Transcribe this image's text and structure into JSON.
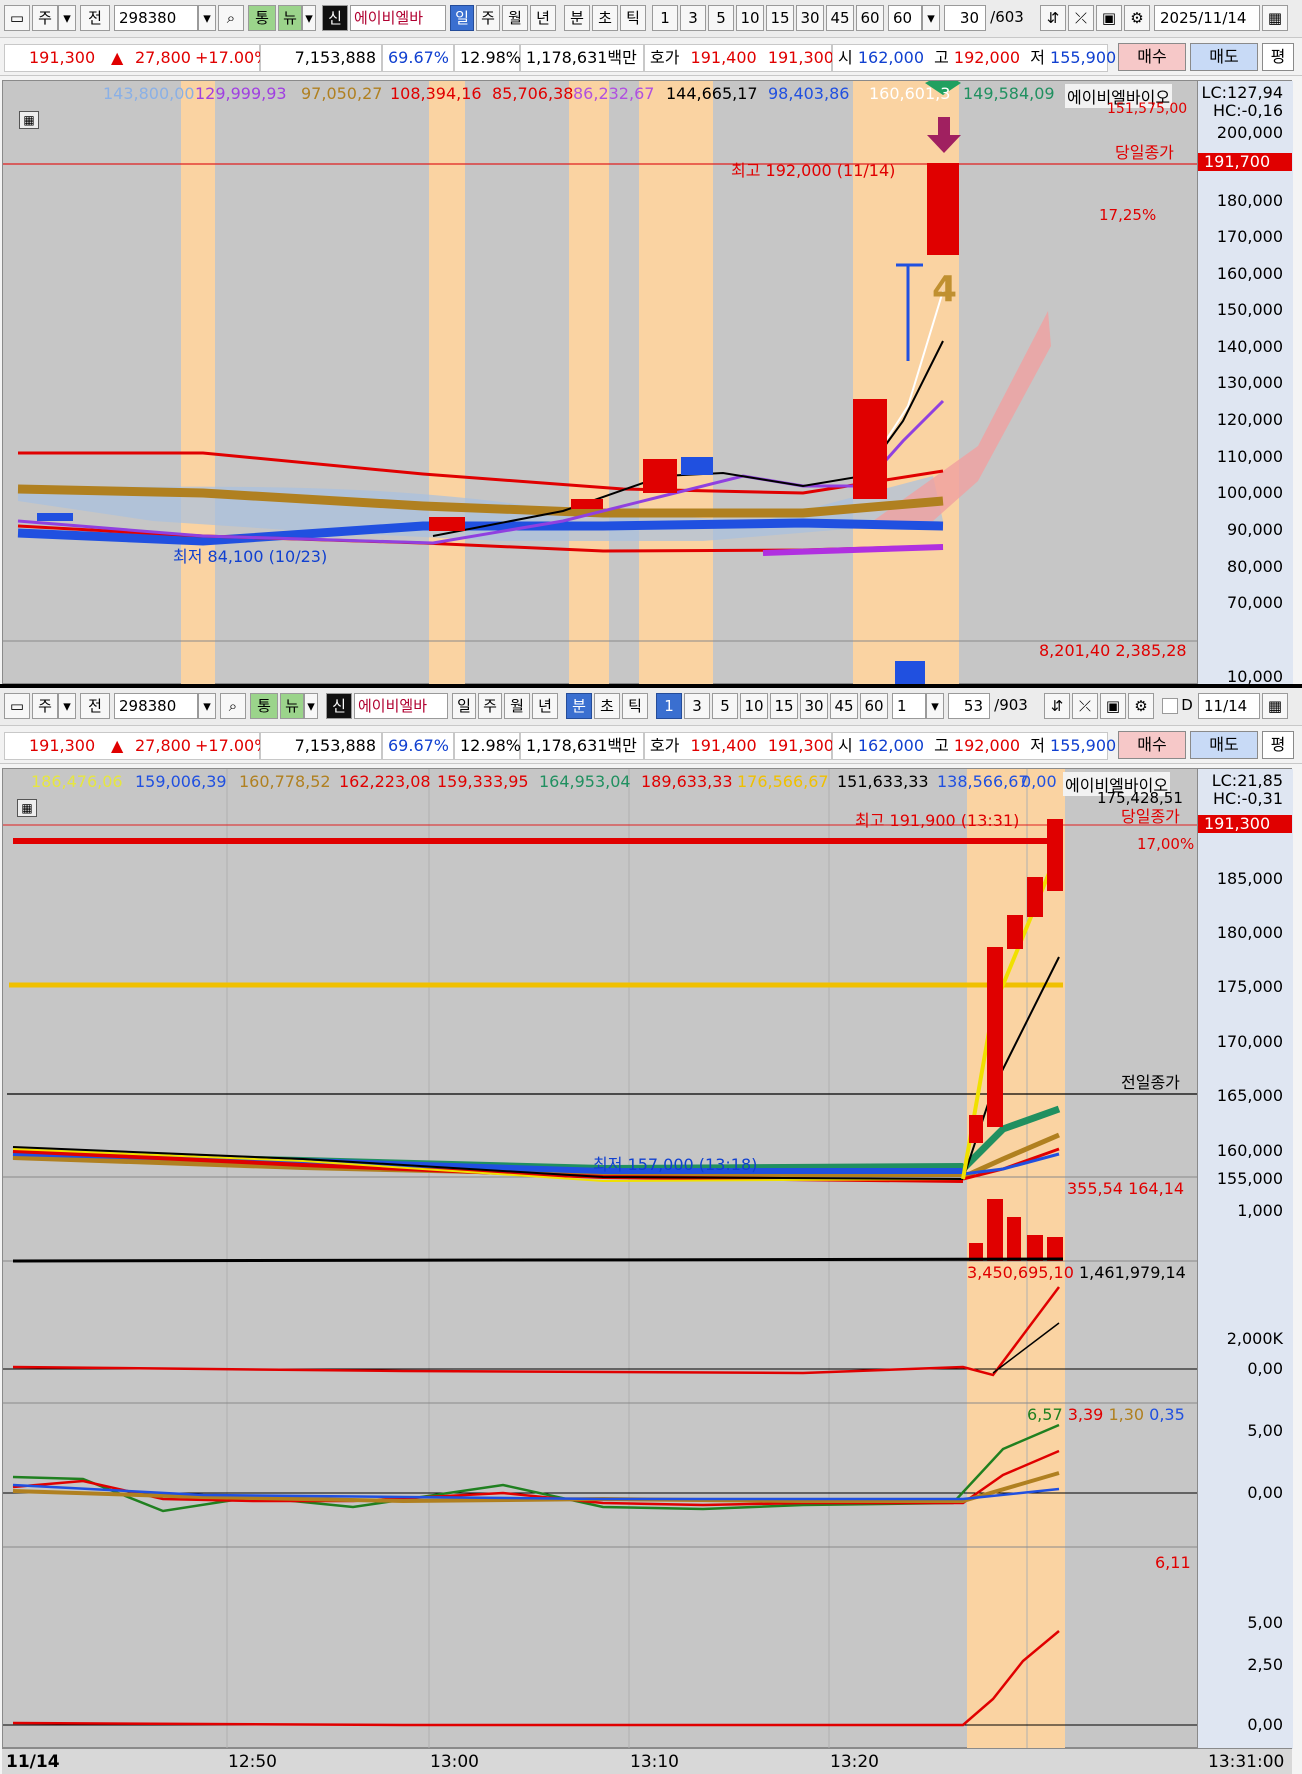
{
  "top": {
    "toolbar": {
      "tab_1": "주",
      "tab_2": "전",
      "code": "298380",
      "badge_tong": "통",
      "badge_nyu": "뉴",
      "badge_sin": "신",
      "name": "에이비엘바",
      "periods": [
        "일",
        "주",
        "월",
        "년",
        "분",
        "초",
        "틱"
      ],
      "active_period": "일",
      "intervals": [
        "1",
        "3",
        "5",
        "10",
        "15",
        "30",
        "45",
        "60"
      ],
      "interval_box": "60",
      "count": "30",
      "count_total": "/603",
      "date": "2025/11/14"
    },
    "quote": {
      "price": "191,300",
      "change": "27,800",
      "change_pct": "+17.00%",
      "volume": "7,153,888",
      "pct1": "69.67%",
      "pct2": "12.98%",
      "amount": "1,178,631백만",
      "ho_label": "호가",
      "ask": "191,400",
      "bid": "191,300",
      "open_label": "시",
      "open": "162,000",
      "high_label": "고",
      "high": "192,000",
      "low_label": "저",
      "low": "155,900",
      "buy": "매수",
      "sell": "매도",
      "avg": "평"
    },
    "legend": [
      {
        "text": "143,800,00",
        "color": "#8ab0e6"
      },
      {
        "text": "129,999,93",
        "color": "#a040e0"
      },
      {
        "text": "97,050,27",
        "color": "#b08020"
      },
      {
        "text": "108,394,16",
        "color": "#e00000"
      },
      {
        "text": "85,706,38",
        "color": "#e00000"
      },
      {
        "text": "86,232,67",
        "color": "#b050e0"
      },
      {
        "text": "144,665,17",
        "color": "#000000"
      },
      {
        "text": "98,403,86",
        "color": "#2050e0"
      },
      {
        "text": "160,601,3",
        "color": "#ffffff"
      },
      {
        "text": "149,584,09",
        "color": "#209060"
      }
    ],
    "stock_label": "에이비엘바이오",
    "lc": "LC:127,94",
    "hc": "HC:-0,16",
    "hc_sub": "151,575,00",
    "close_tag": "당일종가",
    "price_tag": "191,700",
    "pct_tag": "17,25%",
    "high_note": "최고 192,000 (11/14)",
    "low_note": "최저 84,100 (10/23)",
    "candle_number": "4",
    "volume_values": "8,201,40 2,385,28",
    "y_ticks": [
      "200,000",
      "190,000",
      "180,000",
      "170,000",
      "160,000",
      "150,000",
      "140,000",
      "130,000",
      "120,000",
      "110,000",
      "100,000",
      "90,000",
      "80,000",
      "70,000"
    ],
    "vol_tick": "10,000"
  },
  "bottom": {
    "toolbar": {
      "tab_1": "주",
      "tab_2": "전",
      "code": "298380",
      "badge_tong": "통",
      "badge_nyu": "뉴",
      "badge_sin": "신",
      "name": "에이비엘바",
      "periods": [
        "일",
        "주",
        "월",
        "년",
        "분",
        "초",
        "틱"
      ],
      "active_period": "분",
      "intervals": [
        "1",
        "3",
        "5",
        "10",
        "15",
        "30",
        "45",
        "60"
      ],
      "active_interval": "1",
      "interval_box": "1",
      "count": "53",
      "count_total": "/903",
      "check_label": "D",
      "date": "11/14"
    },
    "quote": {
      "price": "191,300",
      "change": "27,800",
      "change_pct": "+17.00%",
      "volume": "7,153,888",
      "pct1": "69.67%",
      "pct2": "12.98%",
      "amount": "1,178,631백만",
      "ho_label": "호가",
      "ask": "191,400",
      "bid": "191,300",
      "open_label": "시",
      "open": "162,000",
      "high_label": "고",
      "high": "192,000",
      "low_label": "저",
      "low": "155,900",
      "buy": "매수",
      "sell": "매도",
      "avg": "평"
    },
    "legend": [
      {
        "text": "186,476,06",
        "color": "#e6e640"
      },
      {
        "text": "159,006,39",
        "color": "#2050e0"
      },
      {
        "text": "160,778,52",
        "color": "#b08020"
      },
      {
        "text": "162,223,08",
        "color": "#e00000"
      },
      {
        "text": "159,333,95",
        "color": "#e00000"
      },
      {
        "text": "164,953,04",
        "color": "#209060"
      },
      {
        "text": "189,633,33",
        "color": "#e00000"
      },
      {
        "text": "176,566,67",
        "color": "#f0c000"
      },
      {
        "text": "151,633,33",
        "color": "#000000"
      },
      {
        "text": "138,566,67",
        "color": "#2050e0"
      },
      {
        "text": "0,00",
        "color": "#2050e0"
      }
    ],
    "stock_label": "에이비엘바이오",
    "lc": "LC:21,85",
    "hc": "HC:-0,31",
    "hc_sub": "175,428,51",
    "close_tag": "당일종가",
    "price_tag": "191,300",
    "pct_tag": "17,00%",
    "high_note": "최고 191,900 (13:31)",
    "low_note": "최저 157,000 (13:18)",
    "prev_close": "전일종가",
    "y_ticks": [
      "185,000",
      "180,000",
      "175,000",
      "170,000",
      "165,000",
      "160,000",
      "155,000"
    ],
    "vol_values": "355,54 164,14",
    "vol_tick": "1,000",
    "obv_values_red": "3,450,695,10",
    "obv_values_black": "1,461,979,14",
    "obv_ticks": [
      "2,000K",
      "0,00"
    ],
    "macd_values": [
      {
        "text": "6,57",
        "color": "#208020"
      },
      {
        "text": "3,39",
        "color": "#e00000"
      },
      {
        "text": "1,30",
        "color": "#b08020"
      },
      {
        "text": "0,35",
        "color": "#2050e0"
      }
    ],
    "macd_ticks": [
      "5,00",
      "0,00"
    ],
    "last_value": "6,11",
    "last_ticks": [
      "5,00",
      "2,50",
      "0,00"
    ],
    "x_labels": [
      "11/14",
      "12:50",
      "13:00",
      "13:10",
      "13:20"
    ],
    "x_end": "13:31:00"
  }
}
